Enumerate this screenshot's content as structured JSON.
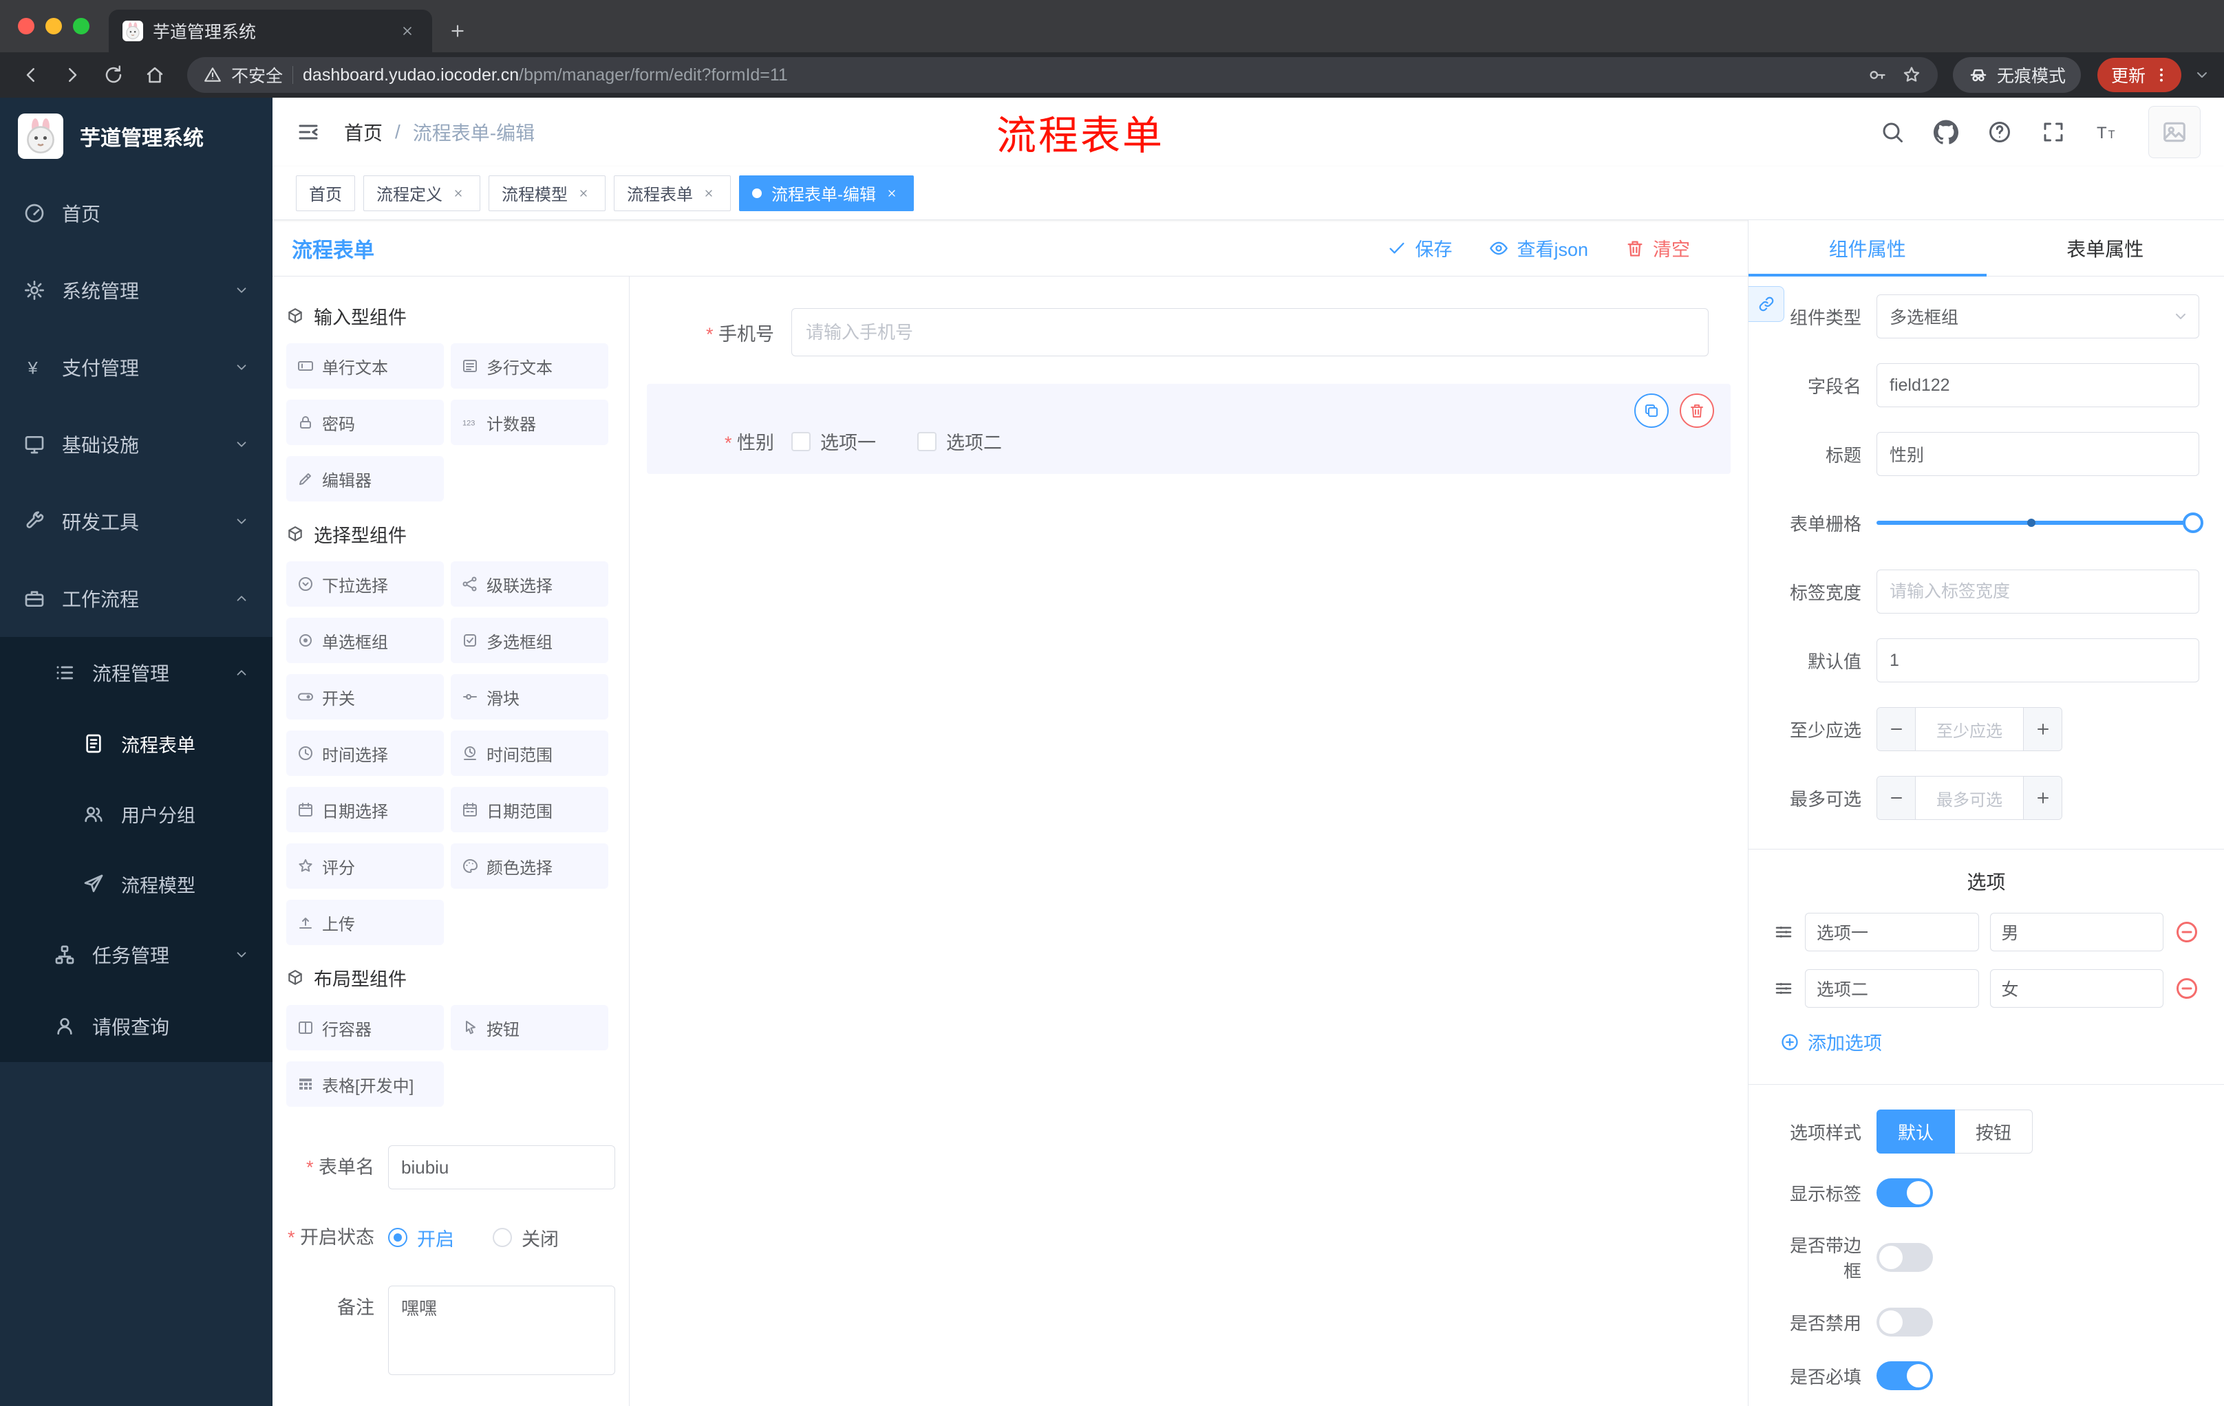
{
  "browser": {
    "tab_title": "芋道管理系统",
    "security_label": "不安全",
    "url_domain": "dashboard.yudao.iocoder.cn",
    "url_path": "/bpm/manager/form/edit?formId=11",
    "incognito_label": "无痕模式",
    "update_label": "更新"
  },
  "sidebar": {
    "app_title": "芋道管理系统",
    "items": [
      {
        "label": "首页",
        "icon": "dashboard-icon"
      },
      {
        "label": "系统管理",
        "icon": "gear-icon"
      },
      {
        "label": "支付管理",
        "icon": "yen-icon"
      },
      {
        "label": "基础设施",
        "icon": "monitor-icon"
      },
      {
        "label": "研发工具",
        "icon": "tool-icon"
      },
      {
        "label": "工作流程",
        "icon": "briefcase-icon"
      },
      {
        "label": "流程管理",
        "icon": "list-icon"
      },
      {
        "label": "流程表单",
        "icon": "document-icon"
      },
      {
        "label": "用户分组",
        "icon": "users-icon"
      },
      {
        "label": "流程模型",
        "icon": "send-icon"
      },
      {
        "label": "任务管理",
        "icon": "tree-icon"
      },
      {
        "label": "请假查询",
        "icon": "user-icon"
      }
    ]
  },
  "header": {
    "breadcrumb_home": "首页",
    "breadcrumb_sep": "/",
    "breadcrumb_current": "流程表单-编辑",
    "annotation": "流程表单"
  },
  "tags": [
    {
      "label": "首页"
    },
    {
      "label": "流程定义"
    },
    {
      "label": "流程模型"
    },
    {
      "label": "流程表单"
    },
    {
      "label": "流程表单-编辑"
    }
  ],
  "designer": {
    "panel_title": "流程表单",
    "save_label": "保存",
    "view_json_label": "查看json",
    "clear_label": "清空",
    "group_input_title": "输入型组件",
    "group_select_title": "选择型组件",
    "group_layout_title": "布局型组件",
    "input_items": [
      {
        "label": "单行文本",
        "icon": "input-text-icon"
      },
      {
        "label": "多行文本",
        "icon": "textarea-icon"
      },
      {
        "label": "密码",
        "icon": "lock-icon"
      },
      {
        "label": "计数器",
        "icon": "counter-icon"
      },
      {
        "label": "编辑器",
        "icon": "editor-icon"
      }
    ],
    "select_items": [
      {
        "label": "下拉选择",
        "icon": "select-down-icon"
      },
      {
        "label": "级联选择",
        "icon": "cascade-icon"
      },
      {
        "label": "单选框组",
        "icon": "radio-icon"
      },
      {
        "label": "多选框组",
        "icon": "checkbox-icon"
      },
      {
        "label": "开关",
        "icon": "switch-icon"
      },
      {
        "label": "滑块",
        "icon": "slider-icon"
      },
      {
        "label": "时间选择",
        "icon": "time-icon"
      },
      {
        "label": "时间范围",
        "icon": "time-range-icon"
      },
      {
        "label": "日期选择",
        "icon": "date-icon"
      },
      {
        "label": "日期范围",
        "icon": "date-range-icon"
      },
      {
        "label": "评分",
        "icon": "rating-star-icon"
      },
      {
        "label": "颜色选择",
        "icon": "color-icon"
      },
      {
        "label": "上传",
        "icon": "upload-icon"
      }
    ],
    "layout_items": [
      {
        "label": "行容器",
        "icon": "row-icon"
      },
      {
        "label": "按钮",
        "icon": "button-icon"
      },
      {
        "label": "表格[开发中]",
        "icon": "table-icon"
      }
    ],
    "meta": {
      "name_label": "表单名",
      "name_value": "biubiu",
      "status_label": "开启状态",
      "status_on": "开启",
      "status_off": "关闭",
      "remark_label": "备注",
      "remark_value": "嘿嘿"
    }
  },
  "canvas": {
    "phone_label": "手机号",
    "phone_placeholder": "请输入手机号",
    "gender_label": "性别",
    "gender_option1": "选项一",
    "gender_option2": "选项二"
  },
  "props": {
    "tab_component": "组件属性",
    "tab_form": "表单属性",
    "type_label": "组件类型",
    "type_value": "多选框组",
    "field_label": "字段名",
    "field_value": "field122",
    "title_label": "标题",
    "title_value": "性别",
    "grid_label": "表单栅格",
    "width_label": "标签宽度",
    "width_placeholder": "请输入标签宽度",
    "default_label": "默认值",
    "default_value": "1",
    "min_label": "至少应选",
    "min_placeholder": "至少应选",
    "max_label": "最多可选",
    "max_placeholder": "最多可选",
    "options_title": "选项",
    "options": [
      {
        "label": "选项一",
        "value": "男"
      },
      {
        "label": "选项二",
        "value": "女"
      }
    ],
    "add_option_label": "添加选项",
    "style_label": "选项样式",
    "style_default": "默认",
    "style_button": "按钮",
    "show_label_label": "显示标签",
    "border_label": "是否带边框",
    "disabled_label": "是否禁用",
    "required_label": "是否必填"
  }
}
